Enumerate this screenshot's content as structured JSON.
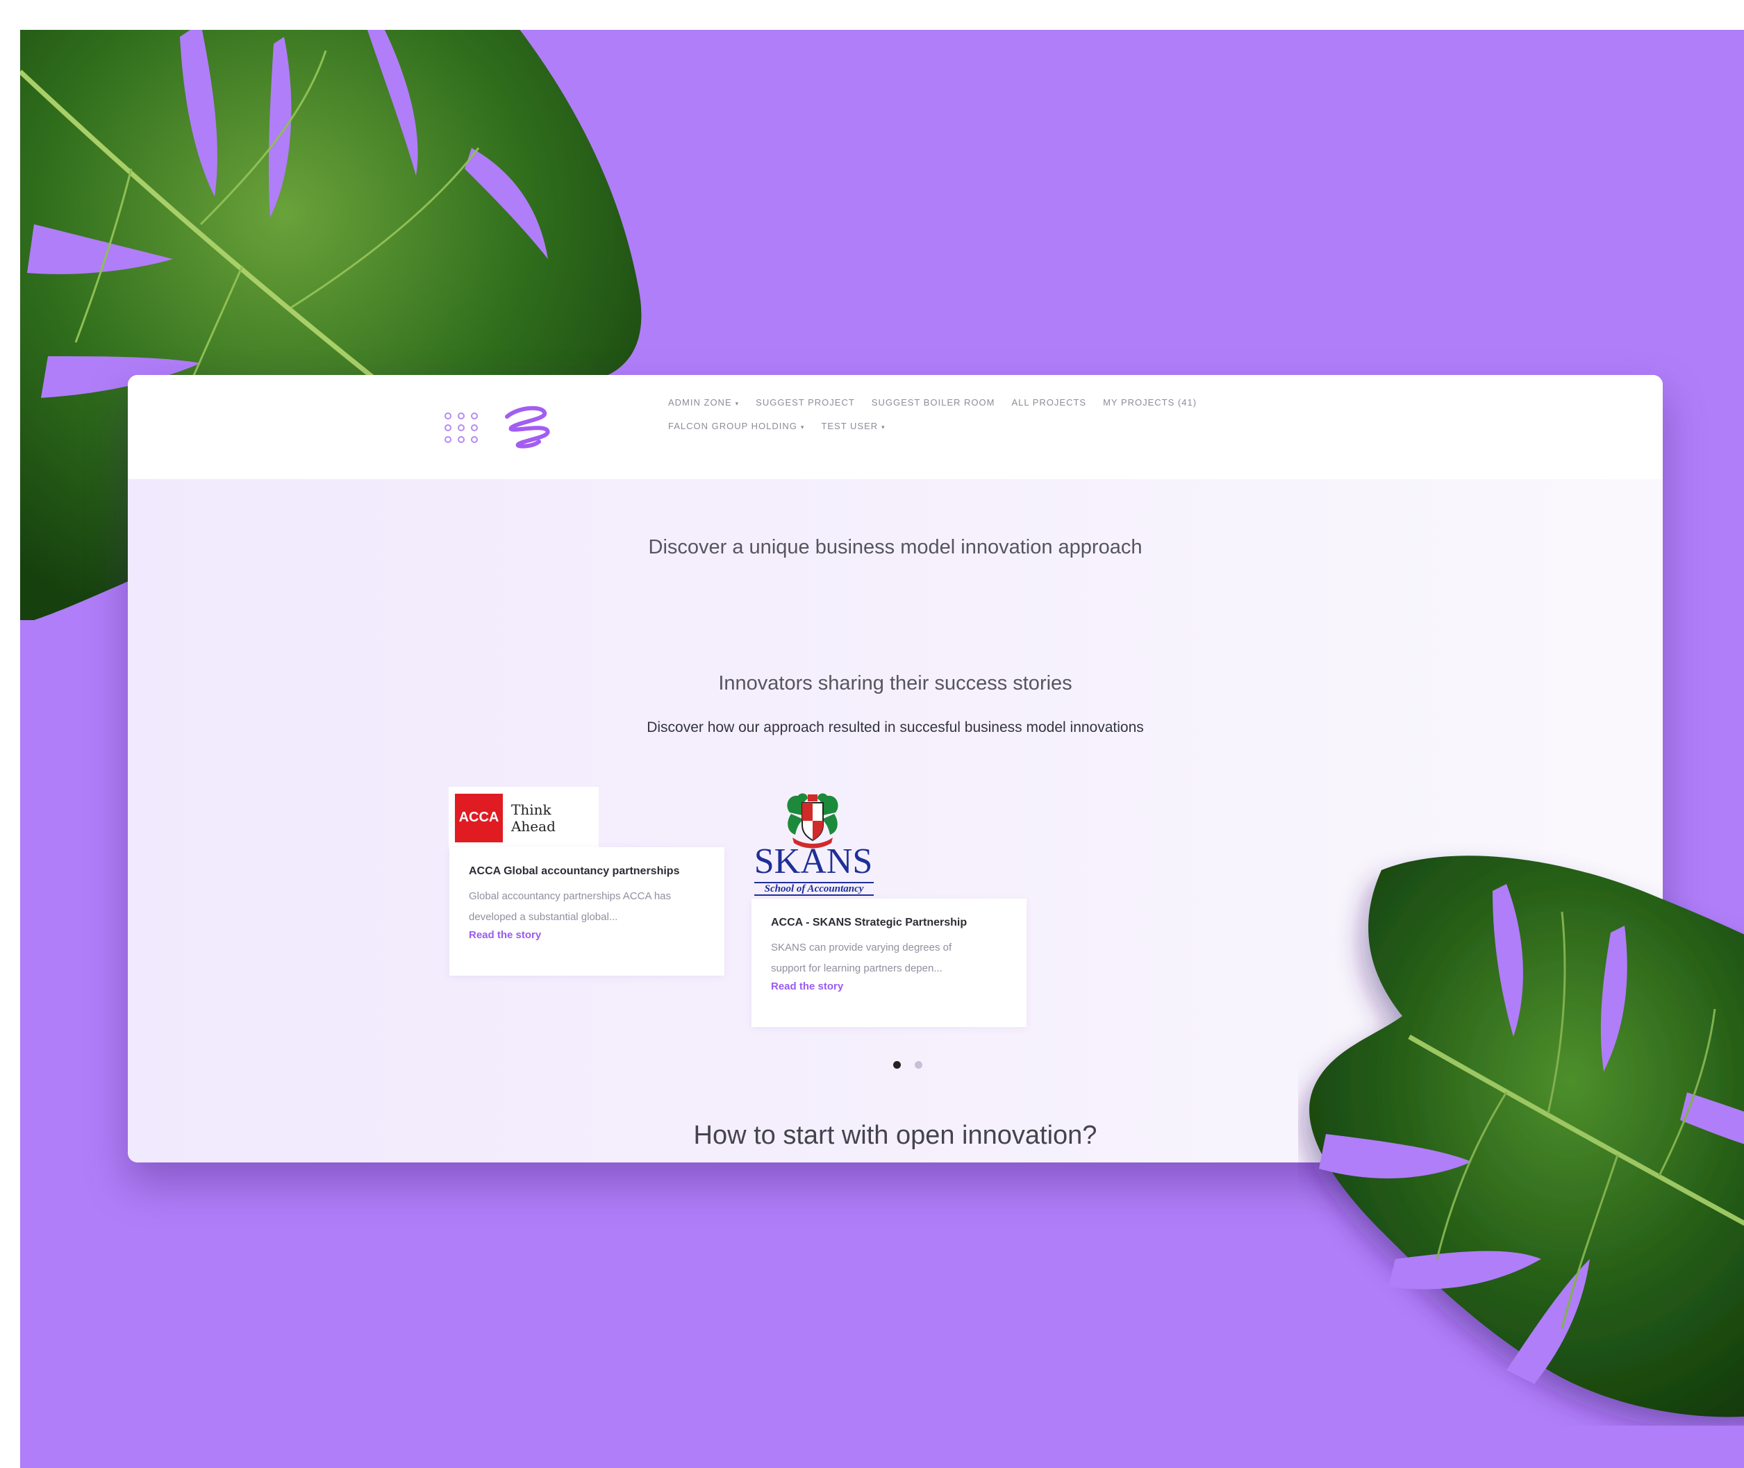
{
  "nav": {
    "row1": [
      {
        "label": "ADMIN ZONE",
        "dropdown": true
      },
      {
        "label": "SUGGEST PROJECT",
        "dropdown": false
      },
      {
        "label": "SUGGEST BOILER ROOM",
        "dropdown": false
      },
      {
        "label": "ALL PROJECTS",
        "dropdown": false
      },
      {
        "label": "MY PROJECTS (41)",
        "dropdown": false
      }
    ],
    "row2": [
      {
        "label": "FALCON GROUP HOLDING",
        "dropdown": true
      },
      {
        "label": "TEST USER",
        "dropdown": true
      }
    ]
  },
  "hero": {
    "title": "Discover a unique business model innovation approach"
  },
  "stories": {
    "title": "Innovators sharing their success stories",
    "subtitle": "Discover how our approach resulted in succesful business model innovations",
    "cards": [
      {
        "logo_text": "ACCA",
        "logo_tagline": "Think Ahead",
        "title": "ACCA Global accountancy partnerships",
        "desc_line1": "Global accountancy partnerships ACCA has",
        "desc_line2": "developed a substantial global...",
        "link": "Read the story"
      },
      {
        "logo_text": "SKANS",
        "logo_tagline": "School of Accountancy",
        "title": "ACCA - SKANS Strategic Partnership",
        "desc_line1": "SKANS can provide varying degrees of",
        "desc_line2": "support for learning partners depen...",
        "link": "Read the story"
      }
    ],
    "carousel": {
      "total": 2,
      "active": 1
    }
  },
  "how": {
    "title": "How to start with open innovation?"
  },
  "colors": {
    "background": "#b07ef8",
    "accent": "#9a5cf0",
    "acca_red": "#e01b22",
    "skans_blue": "#1e2f96"
  },
  "icons": [
    "logo-dots-icon",
    "logo-scribble-icon",
    "chevron-down-icon",
    "crest-icon",
    "monstera-leaf"
  ]
}
